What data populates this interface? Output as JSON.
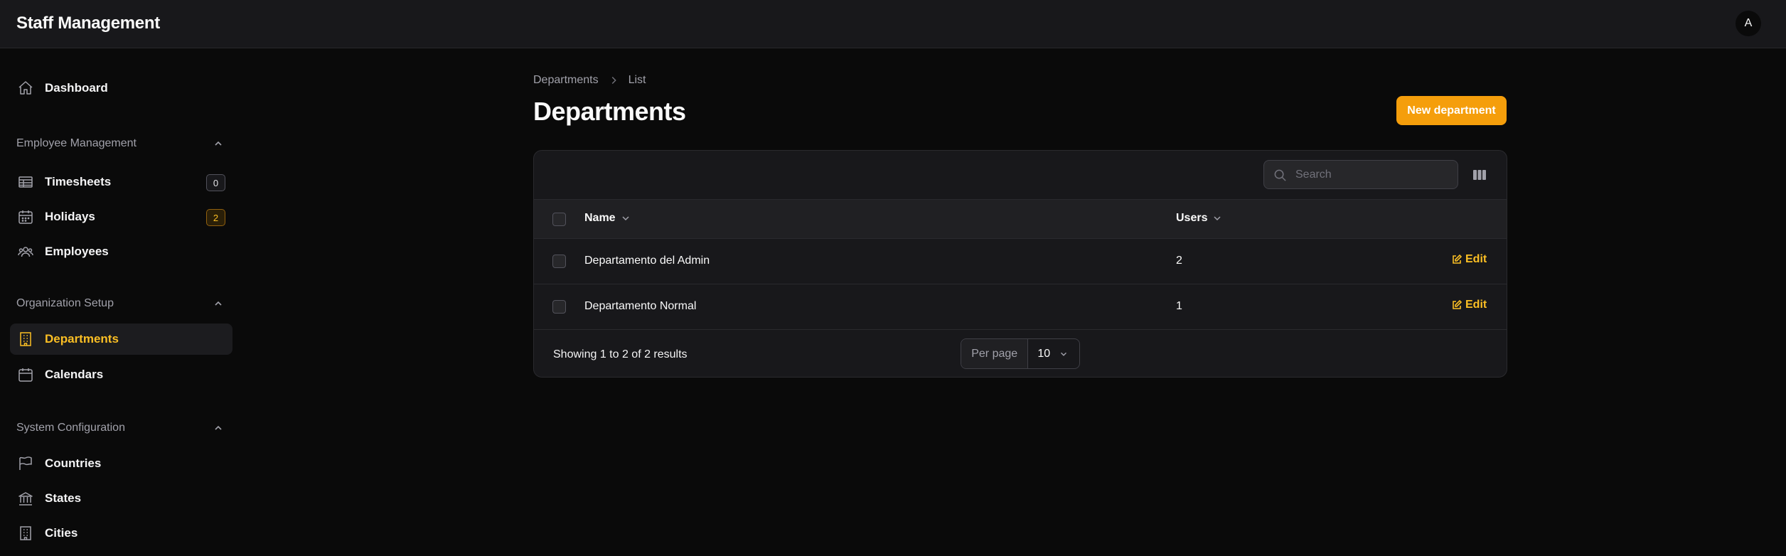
{
  "app": {
    "title": "Staff Management",
    "avatar_initial": "A"
  },
  "sidebar": {
    "dashboard": {
      "label": "Dashboard",
      "icon": "home-icon"
    },
    "groups": [
      {
        "label": "Employee Management",
        "items": [
          {
            "label": "Timesheets",
            "icon": "table-icon",
            "badge": "0"
          },
          {
            "label": "Holidays",
            "icon": "calendar-icon",
            "badge": "2"
          },
          {
            "label": "Employees",
            "icon": "users-icon"
          }
        ]
      },
      {
        "label": "Organization Setup",
        "items": [
          {
            "label": "Departments",
            "icon": "building-icon",
            "active": true
          },
          {
            "label": "Calendars",
            "icon": "calendar-icon"
          }
        ]
      },
      {
        "label": "System Configuration",
        "items": [
          {
            "label": "Countries",
            "icon": "flag-icon"
          },
          {
            "label": "States",
            "icon": "bank-icon"
          },
          {
            "label": "Cities",
            "icon": "building-icon"
          }
        ]
      }
    ]
  },
  "breadcrumb": [
    "Departments",
    "List"
  ],
  "page": {
    "title": "Departments",
    "new_button": "New department"
  },
  "table": {
    "search_placeholder": "Search",
    "columns": [
      "Name",
      "Users"
    ],
    "rows": [
      {
        "name": "Departamento del Admin",
        "users": "2",
        "action": "Edit"
      },
      {
        "name": "Departamento Normal",
        "users": "1",
        "action": "Edit"
      }
    ],
    "summary": "Showing 1 to 2 of 2 results",
    "per_page_label": "Per page",
    "per_page_value": "10"
  },
  "colors": {
    "accent": "#f59e0b",
    "accent_text": "#fbbf24",
    "background": "#0a0a0a",
    "surface": "#18181b"
  }
}
